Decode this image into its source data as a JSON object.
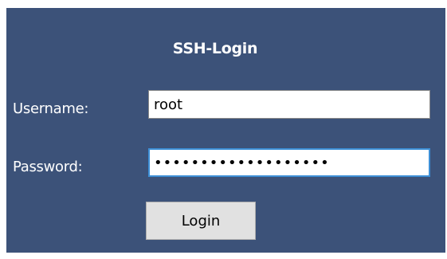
{
  "dialog": {
    "title": "SSH-Login",
    "username_label": "Username:",
    "username_value": "root",
    "password_label": "Password:",
    "password_value": "passwordpassword123",
    "login_label": "Login"
  },
  "colors": {
    "panel_background": "#3c5279",
    "focus_border": "#3d8fd6",
    "button_background": "#e1e1e1"
  }
}
